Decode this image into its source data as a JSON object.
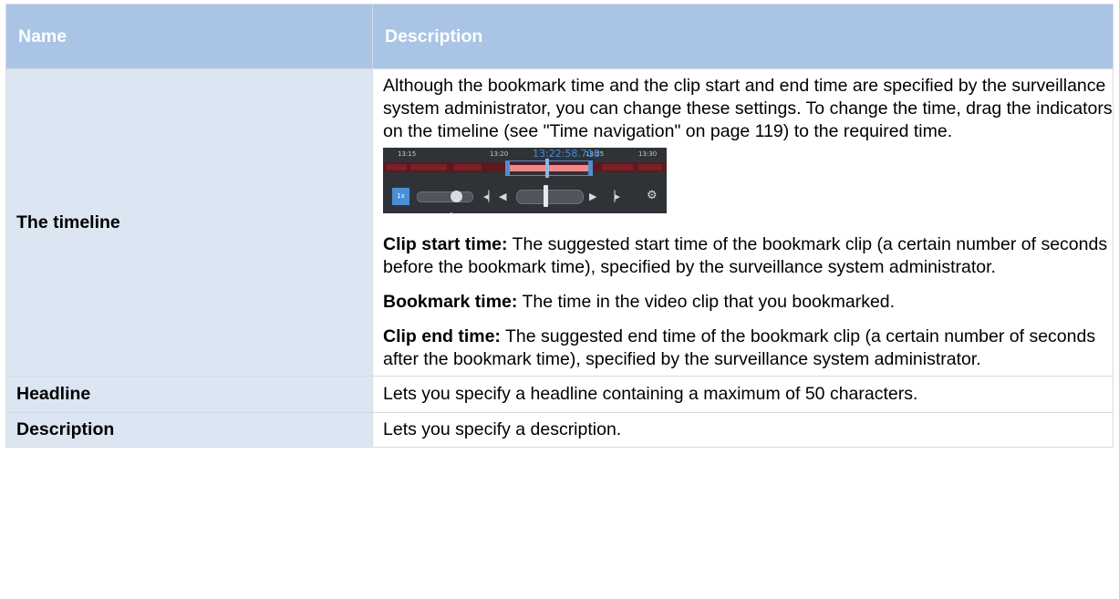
{
  "table": {
    "headers": {
      "name": "Name",
      "description": "Description"
    },
    "rows": {
      "timeline": {
        "name": "The timeline",
        "intro": "Although the bookmark time and the clip start and end time are specified by the surveillance system administrator, you can change these settings. To change the time, drag the indicators on the timeline (see \"Time navigation\" on page 119) to the required time.",
        "items": [
          {
            "term": "Clip start time:",
            "text": " The suggested start time of the bookmark clip (a certain number of seconds before the bookmark time), specified by the surveillance system administrator."
          },
          {
            "term": "Bookmark time:",
            "text": " The time in the video clip that you bookmarked."
          },
          {
            "term": "Clip end time:",
            "text": " The suggested end time of the bookmark clip (a certain number of seconds after the bookmark time), specified by the surveillance system administrator."
          }
        ]
      },
      "headline": {
        "name": "Headline",
        "description": "Lets you specify a headline containing a maximum of 50 characters."
      },
      "description": {
        "name": "Description",
        "description": "Lets you specify a description."
      }
    }
  },
  "timeline_widget": {
    "tick_labels": [
      "13:15",
      "13:20",
      "13:25",
      "13:30"
    ],
    "current_time": "13:22:58.718",
    "speed_button": "1x",
    "speed_value": "1x",
    "icons": {
      "prev_frame": "step-back-icon",
      "play_reverse": "play-reverse-icon",
      "play_forward": "play-forward-icon",
      "next_frame": "step-forward-icon",
      "settings": "gear-icon"
    },
    "colors": {
      "background": "#2f3338",
      "track": "#5a1a1f",
      "selection": "#f0888e",
      "accent": "#4e8fd0"
    }
  },
  "colors": {
    "header_bg": "#a9c4e5",
    "name_col_bg": "#dce6f2",
    "border": "#d6dbe3"
  }
}
